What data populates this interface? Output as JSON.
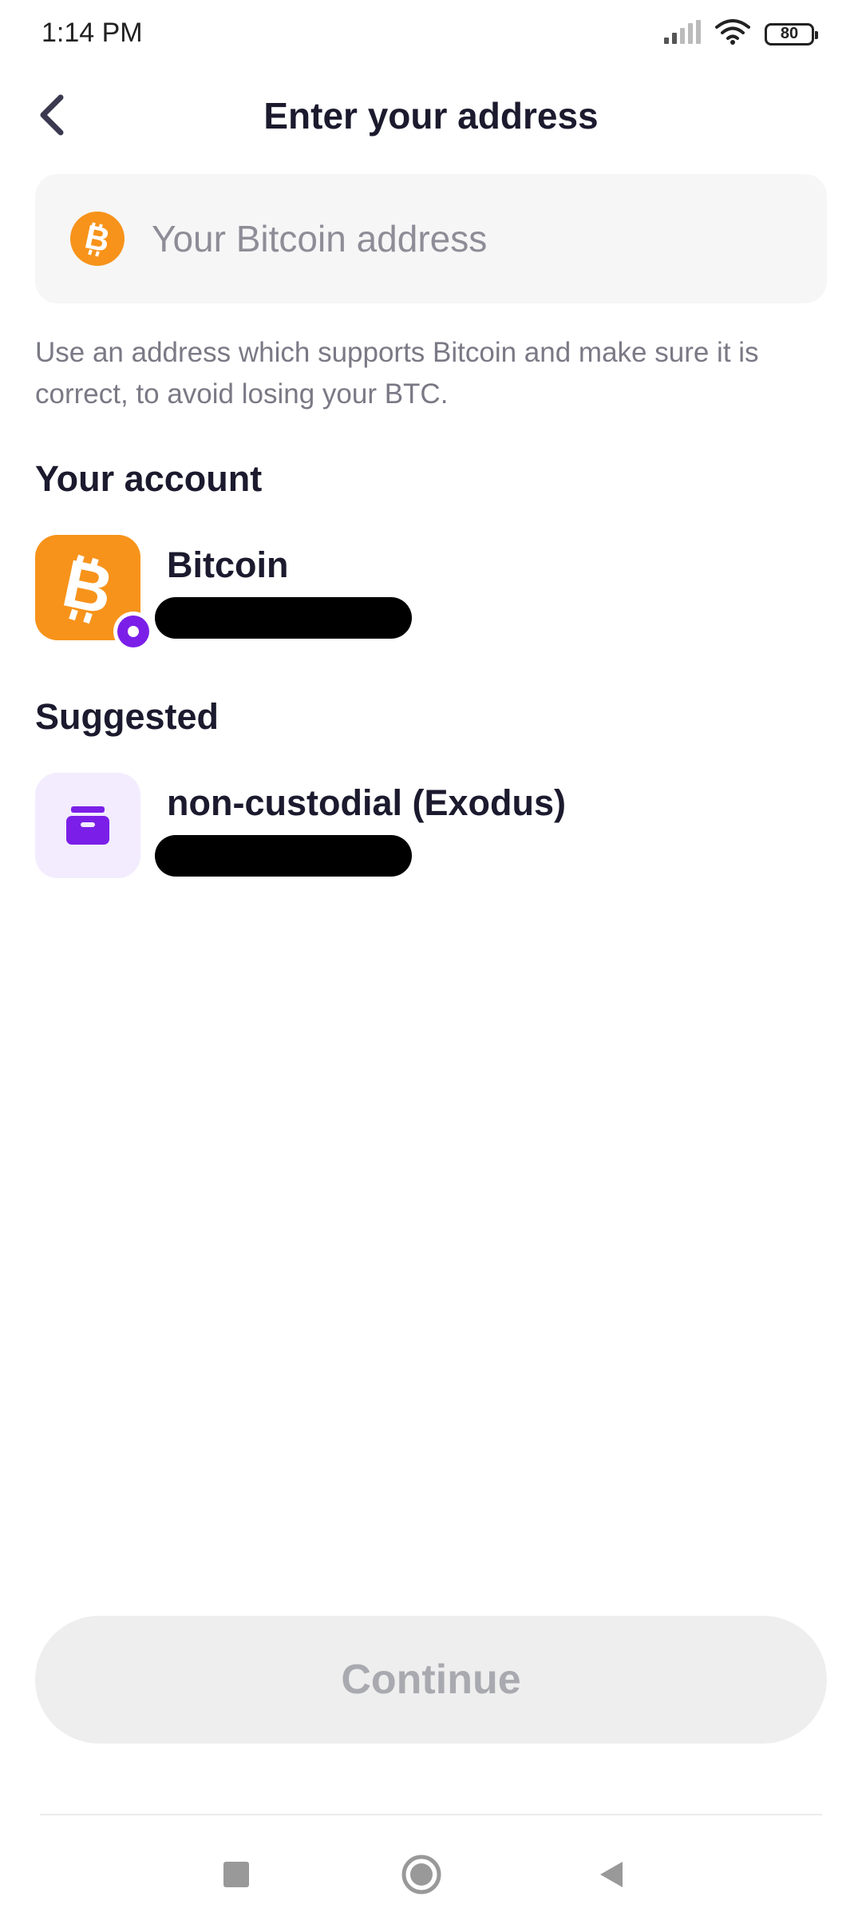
{
  "status_bar": {
    "time": "1:14 PM",
    "battery": "80",
    "icons": [
      "signal-icon",
      "wifi-icon",
      "battery-icon"
    ]
  },
  "header": {
    "title": "Enter your address",
    "back_icon": "chevron-left-icon"
  },
  "address_field": {
    "placeholder": "Your Bitcoin address",
    "value": "",
    "icon": "bitcoin-icon"
  },
  "helper_text": "Use an address which supports Bitcoin and make sure it is correct, to avoid losing your BTC.",
  "your_account": {
    "section_title": "Your account",
    "items": [
      {
        "name": "Bitcoin",
        "icon": "bitcoin-icon",
        "subtitle_redacted": true
      }
    ]
  },
  "suggested": {
    "section_title": "Suggested",
    "items": [
      {
        "name": "non-custodial (Exodus)",
        "icon": "wallet-icon",
        "subtitle_redacted": true
      }
    ]
  },
  "continue_button": {
    "label": "Continue",
    "enabled": false
  },
  "nav_bar": {
    "buttons": [
      "recent-apps-icon",
      "home-icon",
      "back-icon"
    ]
  },
  "colors": {
    "bitcoin_orange": "#f7931a",
    "accent_purple": "#7b1fe8",
    "wallet_bg": "#f3ecfe",
    "title_text": "#1b1a2e",
    "muted_text": "#7a7985",
    "field_bg": "#f6f6f7",
    "disabled_button_bg": "#eeeeee",
    "disabled_button_text": "#a9a9b0"
  }
}
